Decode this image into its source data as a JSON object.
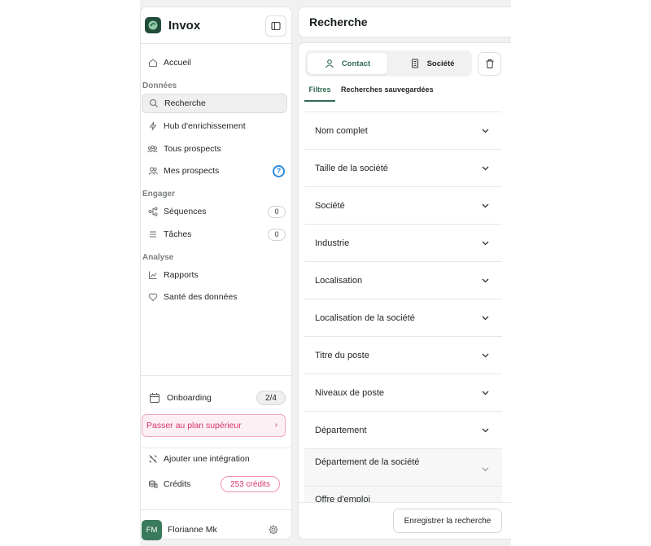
{
  "brand": {
    "name": "Invox"
  },
  "sidebar": {
    "home": "Accueil",
    "section_data": "Données",
    "search": "Recherche",
    "enrichment": "Hub d'enrichissement",
    "all_prospects": "Tous prospects",
    "my_prospects": "Mes prospects",
    "help": "?",
    "section_engage": "Engager",
    "sequences": "Séquences",
    "sequences_count": "0",
    "tasks": "Tâches",
    "tasks_count": "0",
    "section_analysis": "Analyse",
    "reports": "Rapports",
    "data_health": "Santé des données",
    "onboarding": "Onboarding",
    "onboarding_progress": "2/4",
    "upgrade": "Passer au plan supérieur",
    "upgrade_chevron": "›",
    "add_integration": "Ajouter une intégration",
    "credits_label": "Crédits",
    "credits_value": "253 crédits",
    "user_initials": "FM",
    "user_name": "Florianne Mk"
  },
  "main": {
    "title": "Recherche",
    "seg_contact": "Contact",
    "seg_company": "Société",
    "tab_filters": "Filtres",
    "tab_saved": "Recherches sauvegardées",
    "filters": [
      "Nom complet",
      "Taille de la société",
      "Société",
      "Industrie",
      "Localisation",
      "Localisation de la société",
      "Titre du poste",
      "Niveaux de poste",
      "Département",
      "Département de la société",
      "Offre d'emploi"
    ],
    "save_button": "Enregistrer la recherche"
  },
  "colors": {
    "accent_green": "#2f6b4f",
    "brand_dark": "#1f4d3a",
    "upgrade_pink": "#d8336f",
    "help_blue": "#2b8be0"
  }
}
